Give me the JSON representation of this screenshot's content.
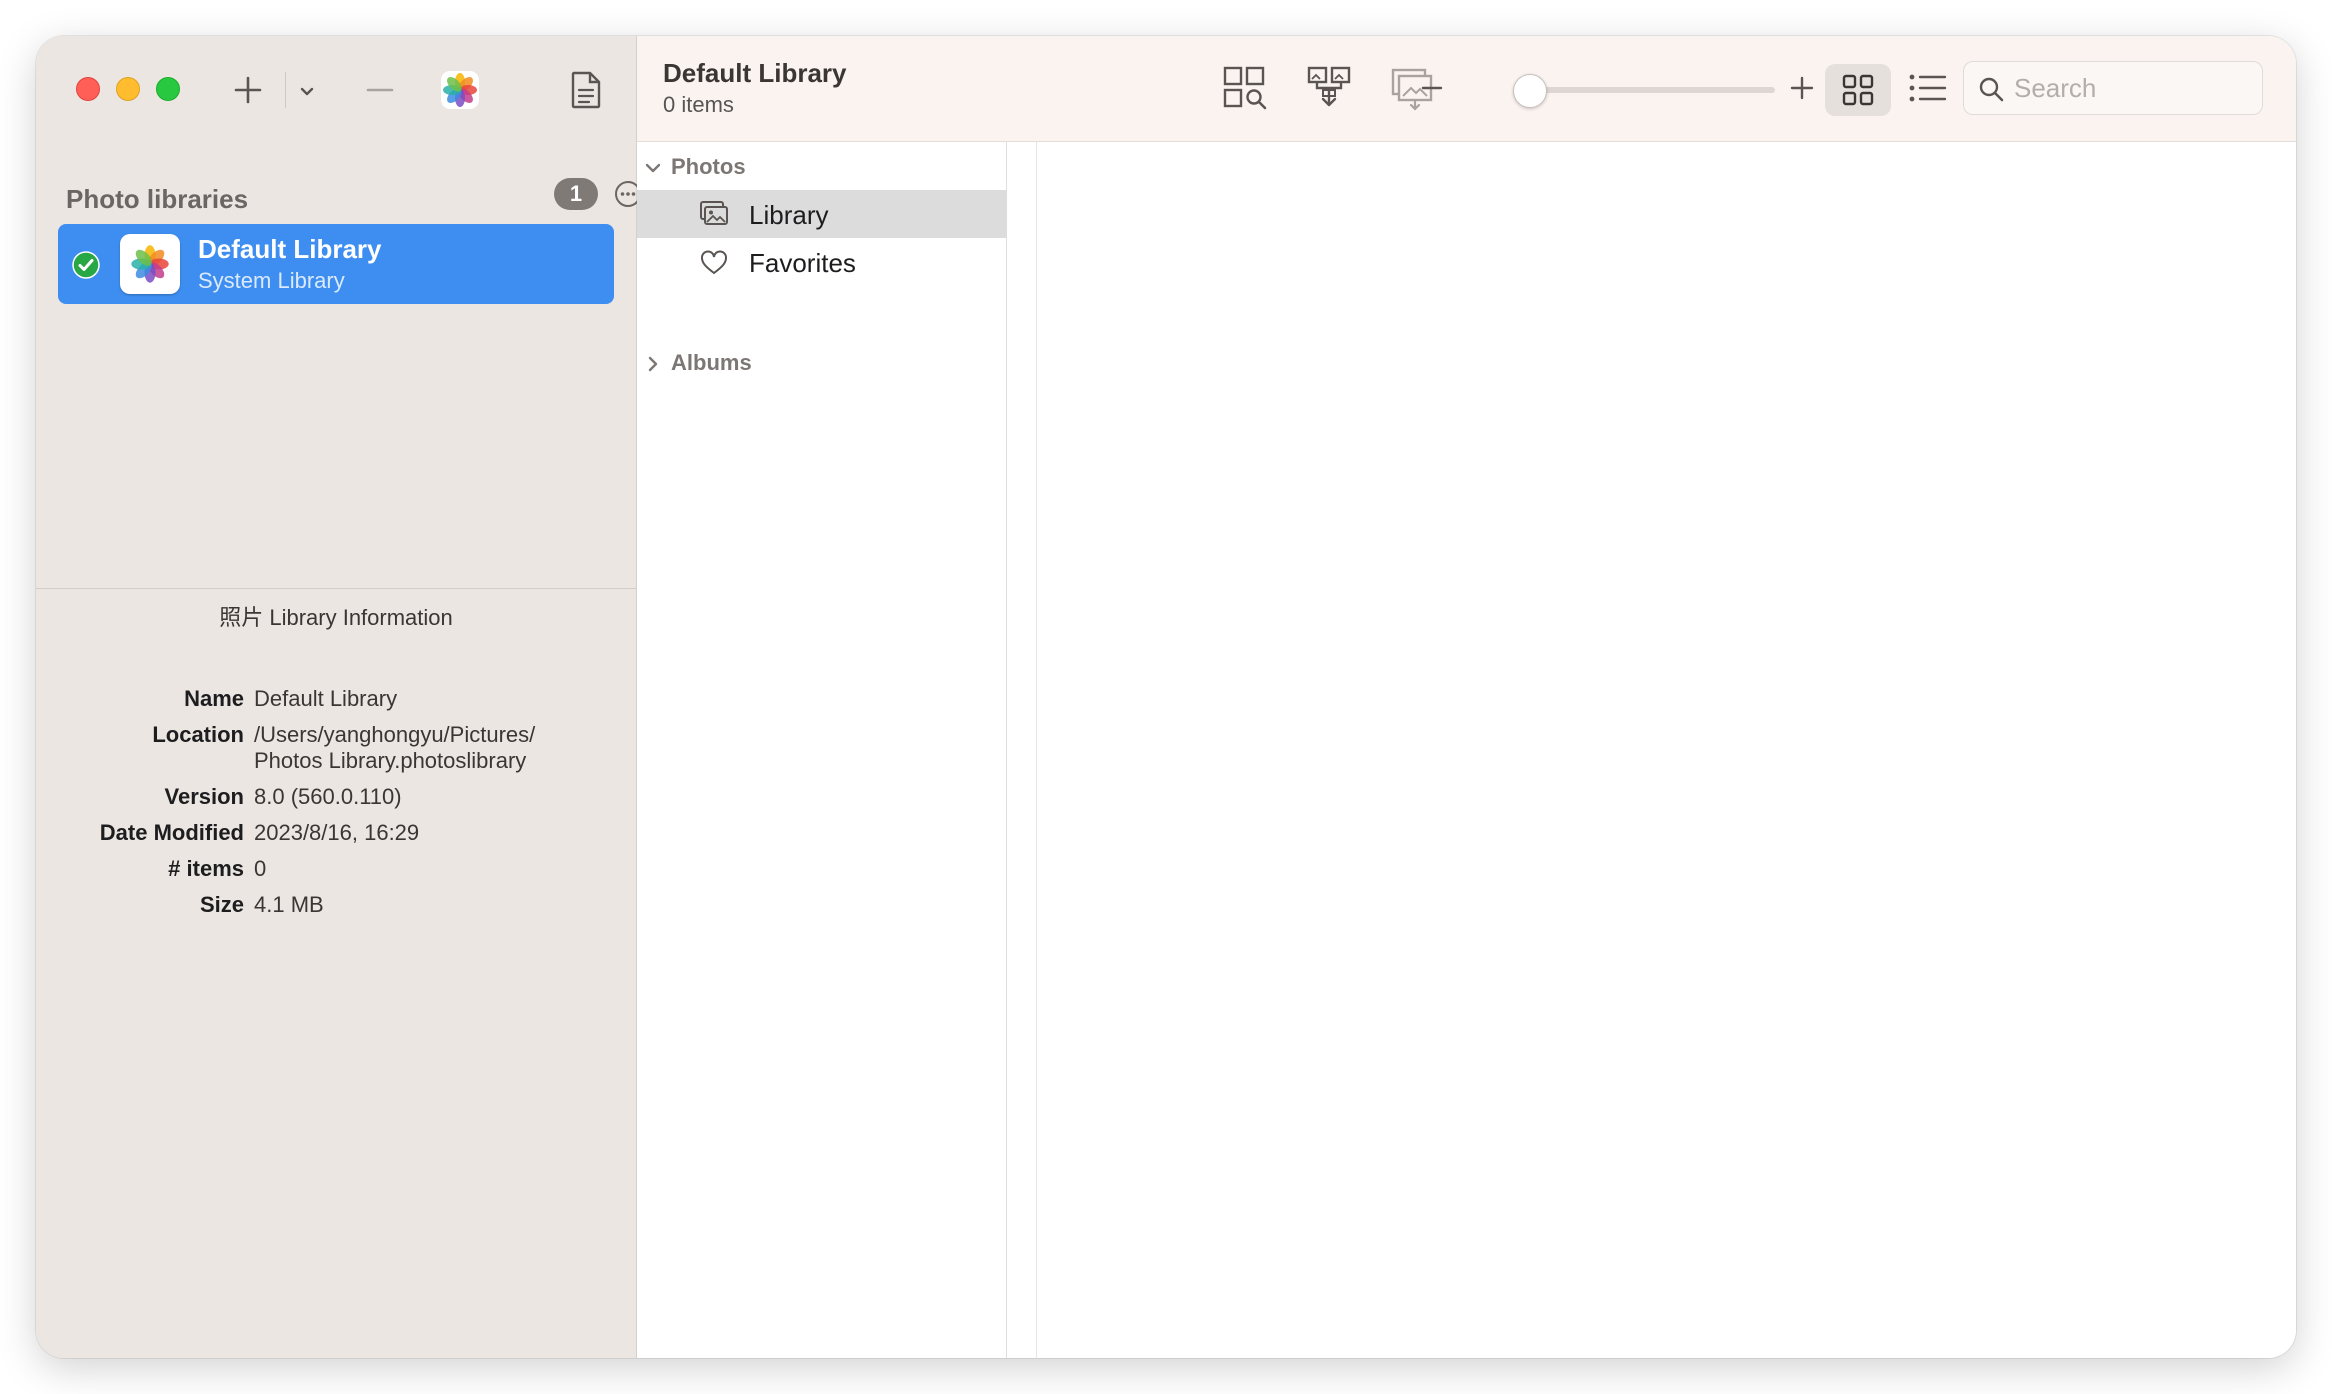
{
  "sidebar": {
    "section_title": "Photo libraries",
    "count": "1",
    "libraries": [
      {
        "name": "Default Library",
        "subtitle": "System Library",
        "checked": true
      }
    ],
    "info": {
      "title": "照片 Library Information",
      "rows": [
        {
          "key": "Name",
          "value": "Default Library"
        },
        {
          "key": "Location",
          "value": "/Users/yanghongyu/Pictures/\nPhotos Library.photoslibrary"
        },
        {
          "key": "Version",
          "value": "8.0 (560.0.110)"
        },
        {
          "key": "Date Modified",
          "value": "2023/8/16, 16:29"
        },
        {
          "key": "# items",
          "value": "0"
        },
        {
          "key": "Size",
          "value": "4.1 MB"
        }
      ]
    }
  },
  "toolbar": {
    "title": "Default Library",
    "subtitle": "0 items",
    "zoom_percent": 0,
    "search_placeholder": "Search"
  },
  "nav": {
    "photos_label": "Photos",
    "items": [
      {
        "label": "Library",
        "icon": "photo-library-icon",
        "selected": true
      },
      {
        "label": "Favorites",
        "icon": "heart-icon",
        "selected": false
      }
    ],
    "albums_label": "Albums"
  },
  "colors": {
    "accent": "#3d8ef0",
    "sidebar_bg": "#ece6e2",
    "toolbar_bg": "#fbf3f0",
    "check_green": "#28a745"
  }
}
